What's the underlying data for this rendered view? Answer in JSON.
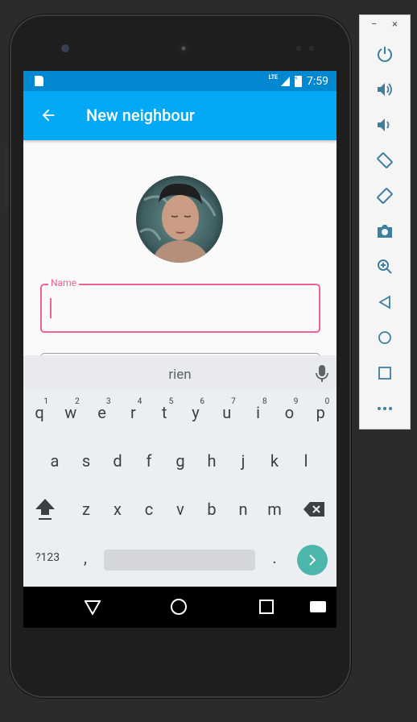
{
  "status_bar": {
    "network": "LTE",
    "time": "7:59"
  },
  "app_bar": {
    "title": "New neighbour"
  },
  "form": {
    "name_label": "Name",
    "name_value": ""
  },
  "keyboard": {
    "suggestion": "rien",
    "row1": [
      {
        "key": "q",
        "sup": "1"
      },
      {
        "key": "w",
        "sup": "2"
      },
      {
        "key": "e",
        "sup": "3"
      },
      {
        "key": "r",
        "sup": "4"
      },
      {
        "key": "t",
        "sup": "5"
      },
      {
        "key": "y",
        "sup": "6"
      },
      {
        "key": "u",
        "sup": "7"
      },
      {
        "key": "i",
        "sup": "8"
      },
      {
        "key": "o",
        "sup": "9"
      },
      {
        "key": "p",
        "sup": "0"
      }
    ],
    "row2": [
      "a",
      "s",
      "d",
      "f",
      "g",
      "h",
      "j",
      "k",
      "l"
    ],
    "row3": [
      "z",
      "x",
      "c",
      "v",
      "b",
      "n",
      "m"
    ],
    "symbols_label": "?123",
    "comma": ",",
    "period": ".",
    "enter_icon": "chevron-right-icon"
  },
  "emulator_toolbar": {
    "window_controls": [
      "−",
      "×"
    ],
    "buttons": [
      "power-icon",
      "volume-up-icon",
      "volume-down-icon",
      "rotate-left-icon",
      "rotate-right-icon",
      "camera-icon",
      "zoom-icon",
      "back-icon",
      "home-icon",
      "overview-icon",
      "more-icon"
    ]
  },
  "colors": {
    "status_bar": "#0288d1",
    "app_bar": "#03a9f4",
    "accent": "#f06292",
    "enter_key": "#4db6ac"
  }
}
